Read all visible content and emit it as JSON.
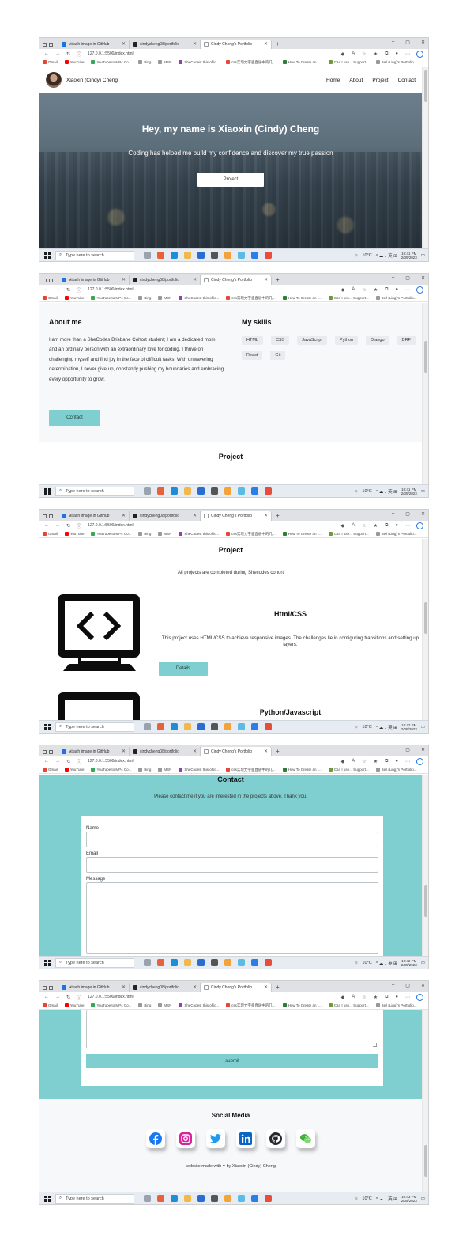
{
  "browser": {
    "tabs": [
      {
        "label": "Attach image in GitHub",
        "fav_color": "#1a73e8"
      },
      {
        "label": "cindycheng08/portfolio",
        "fav_color": "#222222"
      },
      {
        "label": "Cindy Cheng's Portfolio",
        "fav_color": "#ffffff"
      }
    ],
    "new_tab": "+",
    "url": "127.0.0.1:5500/index.html",
    "bookmarks": [
      {
        "label": "Gmail",
        "color": "#ea4335"
      },
      {
        "label": "YouTube",
        "color": "#ff0000"
      },
      {
        "label": "YouTube to MP4 Co...",
        "color": "#34a853"
      },
      {
        "label": "Bing",
        "color": "#777777"
      },
      {
        "label": "MSN",
        "color": "#777777"
      },
      {
        "label": "SheCodes: this offic...",
        "color": "#8e44ad"
      },
      {
        "label": "css实现文字垂直居中的几...",
        "color": "#e8453c"
      },
      {
        "label": "How To Create an I...",
        "color": "#2e7d32"
      },
      {
        "label": "Can I use... Support...",
        "color": "#6d9a3c"
      },
      {
        "label": "Bell (Ling)'s Portfolio...",
        "color": "#777777"
      }
    ],
    "window_controls": {
      "minimize": "–",
      "maximize": "▢",
      "close": "✕"
    }
  },
  "taskbar": {
    "search_placeholder": "Type here to search",
    "weather": "10°C",
    "date": "2/05/2023",
    "times": [
      "10:41 PM",
      "10:41 PM",
      "10:42 PM",
      "10:42 PM",
      "10:43 PM"
    ]
  },
  "site": {
    "brand": "Xiaoxin (Cindy) Cheng",
    "nav": [
      "Home",
      "About",
      "Project",
      "Contact"
    ],
    "hero": {
      "title": "Hey, my name is Xiaoxin (Cindy) Cheng",
      "subtitle": "Coding has helped me build my confidence and discover my true passion",
      "button": "Project"
    },
    "about": {
      "title": "About me",
      "text": "I am more than a SheCodes Brisbane Cohort student; I am a dedicated mom and an ordinary person with an extraordinary love for coding. I thrive on challenging myself and find joy in the face of difficult tasks. With unwavering determination, I never give up, constantly pushing my boundaries and embracing every opportunity to grow.",
      "button": "Contact"
    },
    "skills": {
      "title": "My skills",
      "items": [
        "HTML",
        "CSS",
        "JavaScript",
        "Python",
        "Django",
        "DRF",
        "React",
        "Git"
      ]
    },
    "project": {
      "title": "Project",
      "subtitle": "All projects are completed during Shecodes cohort",
      "items": [
        {
          "title": "Html/CSS",
          "desc": "This project uses HTML/CSS to achieve responsive images. The challenges lie in configuring transitions and setting up layers.",
          "button": "Details"
        },
        {
          "title": "Python/Javascript"
        }
      ]
    },
    "contact": {
      "title": "Contact",
      "subtitle": "Please contact me if you are interested in the projects above. Thank you.",
      "fields": {
        "name": "Name",
        "email": "Email",
        "message": "Message"
      },
      "submit": "submit"
    },
    "social": {
      "title": "Social Media",
      "icons": [
        "facebook-icon",
        "instagram-icon",
        "twitter-icon",
        "linkedin-icon",
        "github-icon",
        "wechat-icon"
      ],
      "footer_pre": "website made with",
      "footer_post": "by Xiaoxin (Cindy) Cheng"
    }
  },
  "colors": {
    "accent": "#7fcfd0",
    "page_bg": "#f7f8fa",
    "dark": "#0c0c0c"
  }
}
